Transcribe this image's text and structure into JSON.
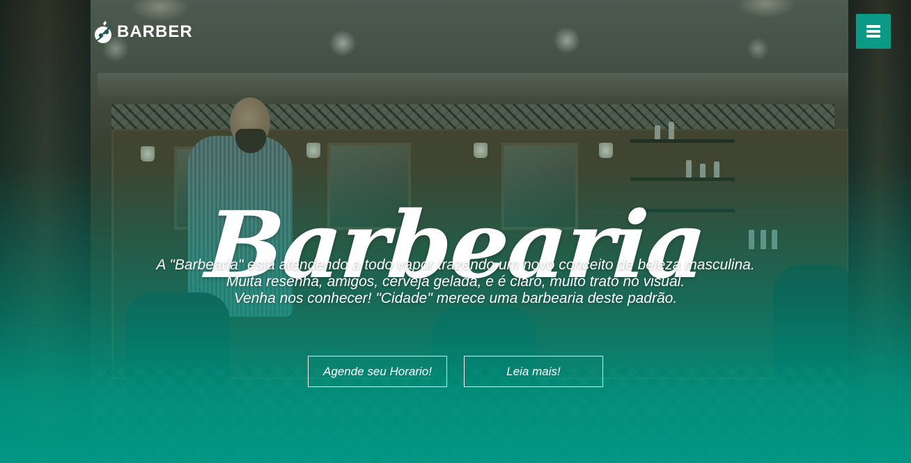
{
  "header": {
    "logo_text": "BARBER",
    "logo_icon": "barber-scissors-logo-icon",
    "menu_icon": "hamburger-menu-icon"
  },
  "hero": {
    "title": "Barbearia",
    "lines": [
      "A \"Barbearia\" está atendendo a todo vapor trazendo um novo conceito de beleza masculina.",
      "Muita resenha, amigos, cerveja gelada, e é claro, muito trato no visual.",
      "Venha nos conhecer! \"Cidade\" merece uma barbearia deste padrão."
    ],
    "buttons": {
      "schedule_label": "Agende seu Horario!",
      "read_more_label": "Leia mais!"
    }
  },
  "colors": {
    "accent": "#0b9a86",
    "overlay_bottom": "#009b87",
    "text": "#ffffff"
  }
}
